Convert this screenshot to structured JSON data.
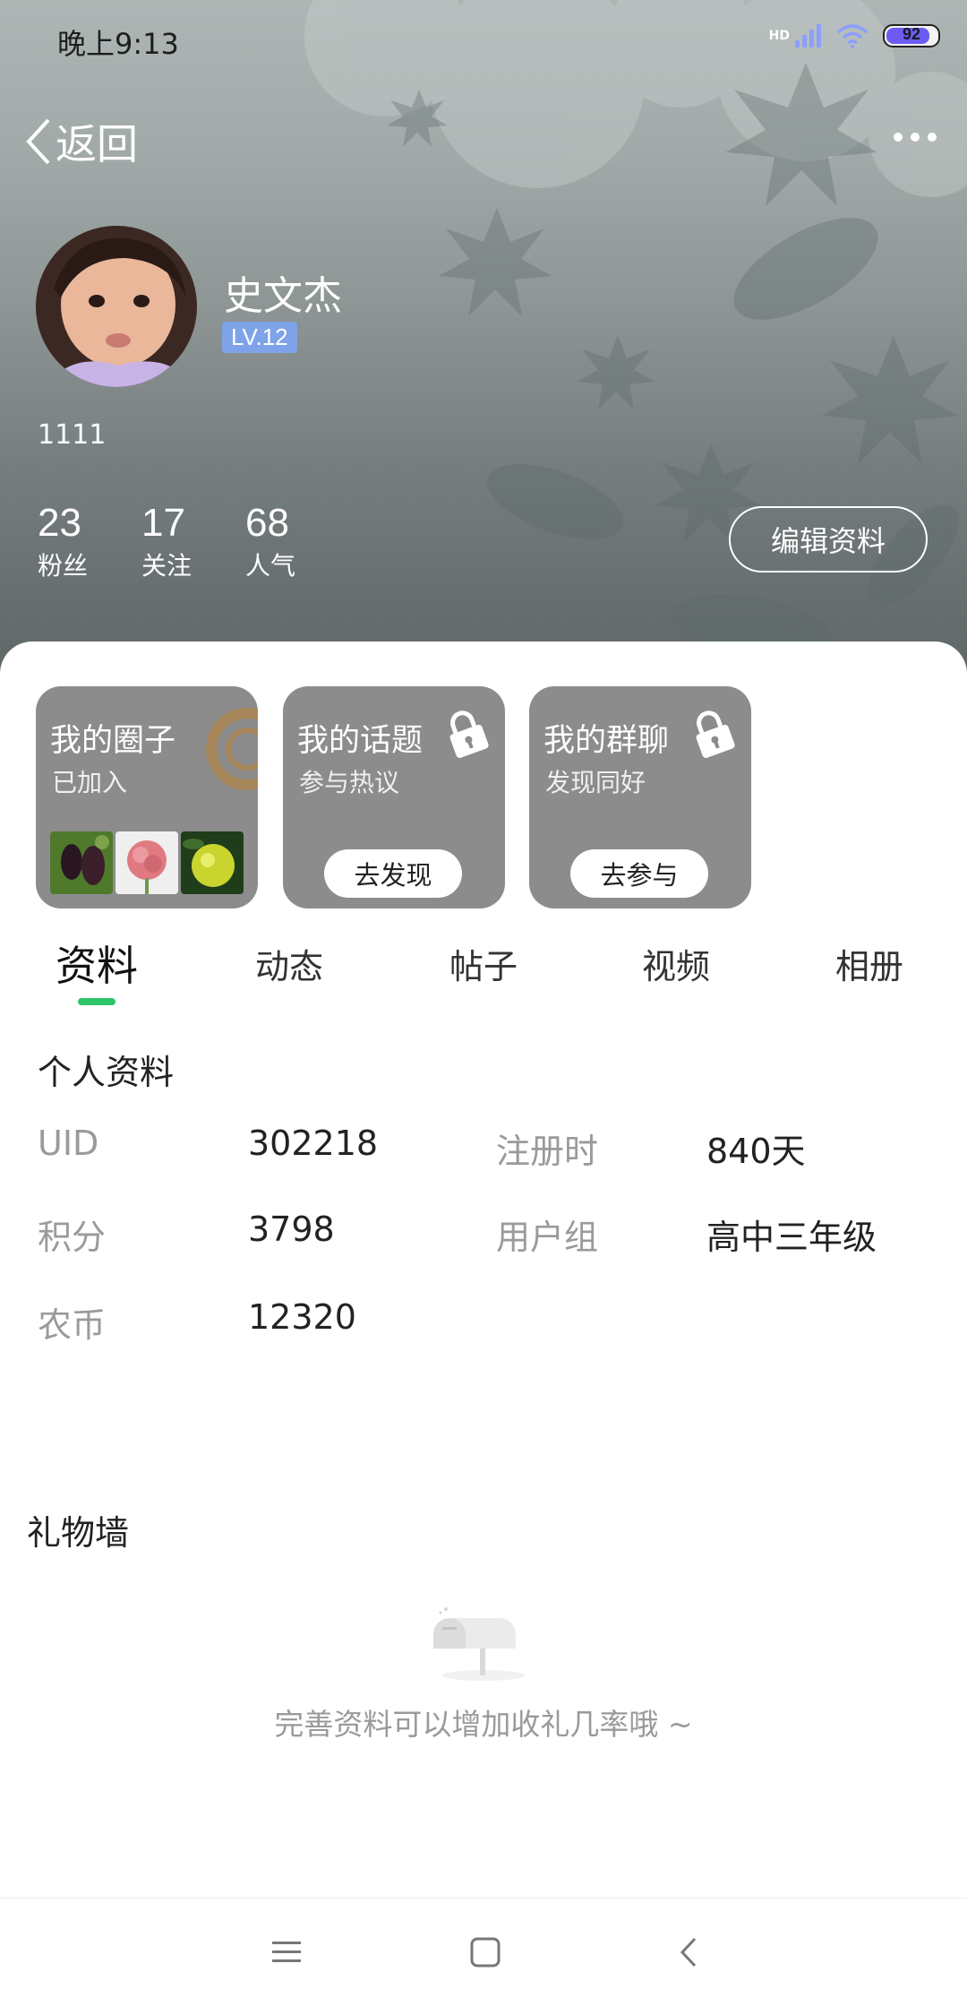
{
  "status_bar": {
    "time": "晚上9:13",
    "network": "HD",
    "battery_level": "92",
    "battery_fraction": 0.92,
    "battery_color": "#6d5cf3"
  },
  "nav": {
    "back_label": "返回"
  },
  "profile": {
    "name": "史文杰",
    "level": "LV.12",
    "signature": "1111",
    "stats": [
      {
        "value": "23",
        "label": "粉丝"
      },
      {
        "value": "17",
        "label": "关注"
      },
      {
        "value": "68",
        "label": "人气"
      }
    ],
    "edit_label": "编辑资料"
  },
  "cards": [
    {
      "title": "我的圈子",
      "subtitle": "已加入"
    },
    {
      "title": "我的话题",
      "subtitle": "参与热议",
      "button": "去发现"
    },
    {
      "title": "我的群聊",
      "subtitle": "发现同好",
      "button": "去参与"
    }
  ],
  "tabs": [
    {
      "label": "资料",
      "active": true
    },
    {
      "label": "动态"
    },
    {
      "label": "帖子"
    },
    {
      "label": "视频"
    },
    {
      "label": "相册"
    }
  ],
  "info": {
    "title": "个人资料",
    "fields": [
      {
        "label": "UID",
        "value": "302218"
      },
      {
        "label": "注册时",
        "value": "840天"
      },
      {
        "label": "积分",
        "value": "3798"
      },
      {
        "label": "用户组",
        "value": "高中三年级"
      },
      {
        "label": "农币",
        "value": "12320"
      }
    ]
  },
  "gift_wall": {
    "title": "礼物墙",
    "empty_text": "完善资料可以增加收礼几率哦 ~"
  },
  "colors": {
    "accent": "#2ec46a",
    "level_badge": "#7ea3e8",
    "card_bg": "#8c8c8c"
  }
}
